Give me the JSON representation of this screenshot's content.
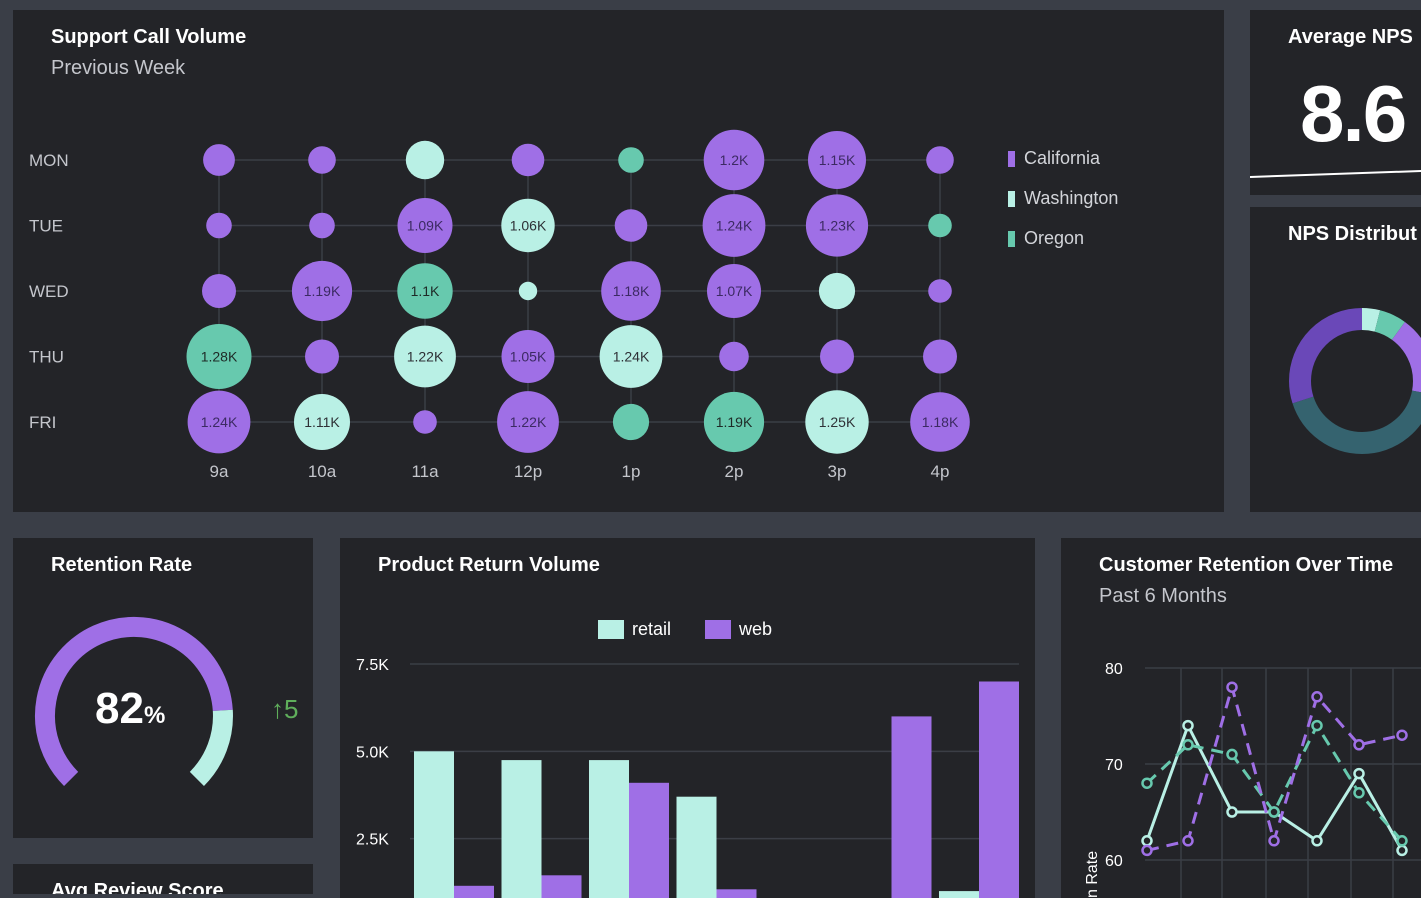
{
  "colors": {
    "purple": "#9f6fe6",
    "mint": "#b9f0e5",
    "teal": "#67c9ae",
    "green_delta": "#5fae5b",
    "panel": "#232428",
    "bg": "#3a3e47"
  },
  "support": {
    "title": "Support Call Volume",
    "subtitle": "Previous Week",
    "chart_data": {
      "type": "bubble",
      "rows": [
        "MON",
        "TUE",
        "WED",
        "THU",
        "FRI"
      ],
      "cols": [
        "9a",
        "10a",
        "11a",
        "12p",
        "1p",
        "2p",
        "3p",
        "4p"
      ],
      "legend": [
        {
          "name": "California",
          "color": "#9f6fe6"
        },
        {
          "name": "Washington",
          "color": "#b9f0e5"
        },
        {
          "name": "Oregon",
          "color": "#67c9ae"
        }
      ],
      "cells": [
        {
          "row": 0,
          "col": 0,
          "s": "California",
          "v": 600,
          "label": ""
        },
        {
          "row": 0,
          "col": 1,
          "s": "California",
          "v": 500,
          "label": ""
        },
        {
          "row": 0,
          "col": 2,
          "s": "Washington",
          "v": 750,
          "label": ""
        },
        {
          "row": 0,
          "col": 3,
          "s": "California",
          "v": 620,
          "label": ""
        },
        {
          "row": 0,
          "col": 4,
          "s": "Oregon",
          "v": 450,
          "label": ""
        },
        {
          "row": 0,
          "col": 5,
          "s": "California",
          "v": 1200,
          "label": "1.2K"
        },
        {
          "row": 0,
          "col": 6,
          "s": "California",
          "v": 1150,
          "label": "1.15K"
        },
        {
          "row": 0,
          "col": 7,
          "s": "California",
          "v": 500,
          "label": ""
        },
        {
          "row": 1,
          "col": 0,
          "s": "California",
          "v": 450,
          "label": ""
        },
        {
          "row": 1,
          "col": 1,
          "s": "California",
          "v": 450,
          "label": ""
        },
        {
          "row": 1,
          "col": 2,
          "s": "California",
          "v": 1090,
          "label": "1.09K"
        },
        {
          "row": 1,
          "col": 3,
          "s": "Washington",
          "v": 1060,
          "label": "1.06K"
        },
        {
          "row": 1,
          "col": 4,
          "s": "California",
          "v": 620,
          "label": ""
        },
        {
          "row": 1,
          "col": 5,
          "s": "California",
          "v": 1240,
          "label": "1.24K"
        },
        {
          "row": 1,
          "col": 6,
          "s": "California",
          "v": 1230,
          "label": "1.23K"
        },
        {
          "row": 1,
          "col": 7,
          "s": "Oregon",
          "v": 400,
          "label": ""
        },
        {
          "row": 2,
          "col": 0,
          "s": "California",
          "v": 650,
          "label": ""
        },
        {
          "row": 2,
          "col": 1,
          "s": "California",
          "v": 1190,
          "label": "1.19K"
        },
        {
          "row": 2,
          "col": 2,
          "s": "Oregon",
          "v": 1100,
          "label": "1.1K"
        },
        {
          "row": 2,
          "col": 3,
          "s": "Washington",
          "v": 250,
          "label": ""
        },
        {
          "row": 2,
          "col": 4,
          "s": "California",
          "v": 1180,
          "label": "1.18K"
        },
        {
          "row": 2,
          "col": 5,
          "s": "California",
          "v": 1070,
          "label": "1.07K"
        },
        {
          "row": 2,
          "col": 6,
          "s": "Washington",
          "v": 700,
          "label": ""
        },
        {
          "row": 2,
          "col": 7,
          "s": "California",
          "v": 400,
          "label": ""
        },
        {
          "row": 3,
          "col": 0,
          "s": "Oregon",
          "v": 1280,
          "label": "1.28K"
        },
        {
          "row": 3,
          "col": 1,
          "s": "California",
          "v": 650,
          "label": ""
        },
        {
          "row": 3,
          "col": 2,
          "s": "Washington",
          "v": 1220,
          "label": "1.22K"
        },
        {
          "row": 3,
          "col": 3,
          "s": "California",
          "v": 1050,
          "label": "1.05K"
        },
        {
          "row": 3,
          "col": 4,
          "s": "Washington",
          "v": 1240,
          "label": "1.24K"
        },
        {
          "row": 3,
          "col": 5,
          "s": "California",
          "v": 550,
          "label": ""
        },
        {
          "row": 3,
          "col": 6,
          "s": "California",
          "v": 650,
          "label": ""
        },
        {
          "row": 3,
          "col": 7,
          "s": "California",
          "v": 650,
          "label": ""
        },
        {
          "row": 4,
          "col": 0,
          "s": "California",
          "v": 1240,
          "label": "1.24K"
        },
        {
          "row": 4,
          "col": 1,
          "s": "Washington",
          "v": 1110,
          "label": "1.11K"
        },
        {
          "row": 4,
          "col": 2,
          "s": "California",
          "v": 400,
          "label": ""
        },
        {
          "row": 4,
          "col": 3,
          "s": "California",
          "v": 1220,
          "label": "1.22K"
        },
        {
          "row": 4,
          "col": 4,
          "s": "Oregon",
          "v": 700,
          "label": ""
        },
        {
          "row": 4,
          "col": 5,
          "s": "Oregon",
          "v": 1190,
          "label": "1.19K"
        },
        {
          "row": 4,
          "col": 6,
          "s": "Washington",
          "v": 1250,
          "label": "1.25K"
        },
        {
          "row": 4,
          "col": 7,
          "s": "California",
          "v": 1180,
          "label": "1.18K"
        }
      ]
    }
  },
  "nps": {
    "title": "Average NPS",
    "value": "8.6"
  },
  "nps_dist": {
    "title": "NPS Distribut",
    "chart_data": {
      "type": "pie",
      "slices": [
        {
          "value": 4,
          "color": "#b9f0e5"
        },
        {
          "value": 6,
          "color": "#67c9ae"
        },
        {
          "value": 18,
          "color": "#9f6fe6"
        },
        {
          "value": 42,
          "color": "#35636f"
        },
        {
          "value": 30,
          "color": "#6a48b8"
        }
      ]
    }
  },
  "retention": {
    "title": "Retention Rate",
    "value": "82",
    "unit": "%",
    "fraction": 0.82,
    "delta_arrow": "↑",
    "delta": "5"
  },
  "returns": {
    "title": "Product Return Volume",
    "chart_data": {
      "type": "bar",
      "series": [
        {
          "name": "retail",
          "color": "#b9f0e5",
          "values": [
            5000,
            4750,
            4750,
            3700,
            0,
            0,
            1000,
            0,
            1400
          ]
        },
        {
          "name": "web",
          "color": "#9f6fe6",
          "values": [
            1150,
            1450,
            4100,
            1050,
            0,
            6000,
            7000,
            6000,
            0
          ]
        }
      ],
      "groups": 7,
      "yticks": [
        "7.5K",
        "5.0K",
        "2.5K"
      ],
      "ytick_values": [
        7500,
        5000,
        2500
      ],
      "ylim": [
        0,
        8300
      ]
    }
  },
  "custret": {
    "title": "Customer Retention Over Time",
    "subtitle": "Past 6 Months",
    "ylabel": "n Rate",
    "chart_data": {
      "type": "line",
      "yticks": [
        "80",
        "70",
        "60"
      ],
      "ytick_values": [
        80,
        70,
        60
      ],
      "ylim": [
        57,
        82
      ],
      "series": [
        {
          "name": "solid-mint",
          "color": "#b9f0e5",
          "dash": false,
          "values": [
            62,
            74,
            65,
            65,
            62,
            69,
            61
          ]
        },
        {
          "name": "dash-teal",
          "color": "#67c9ae",
          "dash": true,
          "values": [
            68,
            72,
            71,
            65,
            74,
            67,
            62
          ]
        },
        {
          "name": "dash-purple",
          "color": "#9f6fe6",
          "dash": true,
          "values": [
            61,
            62,
            78,
            62,
            77,
            72,
            73
          ]
        }
      ]
    }
  },
  "review": {
    "title": "Avg Review Score"
  }
}
